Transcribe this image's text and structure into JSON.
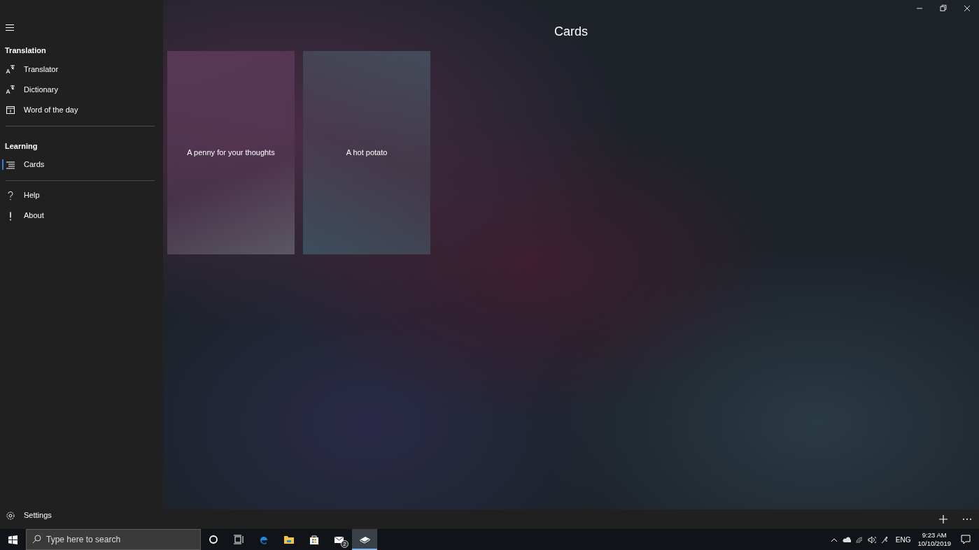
{
  "page": {
    "title": "Cards"
  },
  "nav": {
    "sections": [
      {
        "heading": "Translation",
        "items": [
          {
            "label": "Translator",
            "selected": false
          },
          {
            "label": "Dictionary",
            "selected": false
          },
          {
            "label": "Word of the day",
            "selected": false
          }
        ]
      },
      {
        "heading": "Learning",
        "items": [
          {
            "label": "Cards",
            "selected": true
          }
        ]
      }
    ],
    "footer_items": [
      {
        "label": "Help",
        "selected": false
      },
      {
        "label": "About",
        "selected": false
      }
    ],
    "settings": {
      "label": "Settings"
    }
  },
  "cards": [
    {
      "text": "A penny for your thoughts"
    },
    {
      "text": "A hot potato"
    }
  ],
  "taskbar": {
    "search": {
      "placeholder": "Type here to search"
    },
    "apps": [
      {
        "kind": "cortana",
        "selected": false
      },
      {
        "kind": "taskview",
        "selected": false
      },
      {
        "kind": "edge",
        "selected": false
      },
      {
        "kind": "explorer",
        "selected": false
      },
      {
        "kind": "store",
        "selected": false
      },
      {
        "kind": "mail",
        "selected": false,
        "badge": "2"
      },
      {
        "kind": "app",
        "selected": true
      }
    ],
    "language": "ENG",
    "time": "9:23 AM",
    "date": "10/10/2019"
  }
}
